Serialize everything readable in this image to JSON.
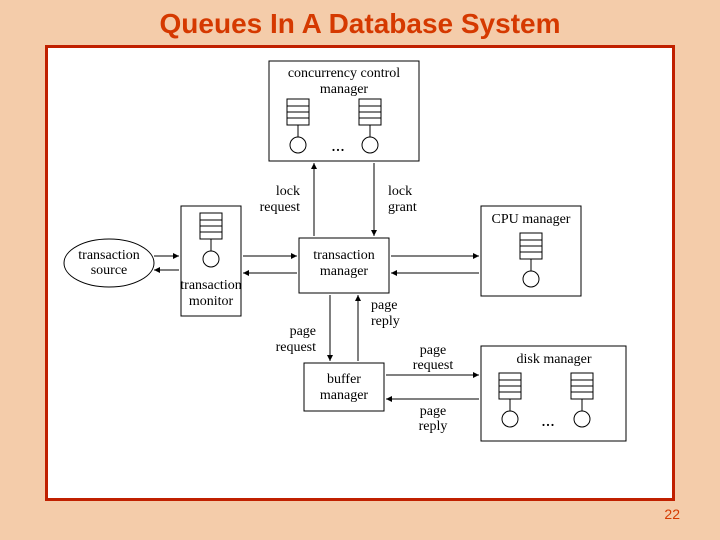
{
  "title": "Queues In A Database System",
  "page_number": "22",
  "boxes": {
    "cc": {
      "label1": "concurrency control",
      "label2": "manager",
      "ellipsis": "..."
    },
    "tm": {
      "label1": "transaction",
      "label2": "manager"
    },
    "mon": {
      "label1": "transaction",
      "label2": "monitor"
    },
    "src": {
      "label1": "transaction",
      "label2": "source"
    },
    "cpu": {
      "label": "CPU manager"
    },
    "buf": {
      "label1": "buffer",
      "label2": "manager"
    },
    "disk": {
      "label": "disk manager",
      "ellipsis": "..."
    }
  },
  "labels": {
    "lock_request": {
      "l1": "lock",
      "l2": "request"
    },
    "lock_grant": {
      "l1": "lock",
      "l2": "grant"
    },
    "page_request_top": {
      "l1": "page",
      "l2": "request"
    },
    "page_reply_top": {
      "l1": "page",
      "l2": "reply"
    },
    "page_request_bot": {
      "l1": "page",
      "l2": "request"
    },
    "page_reply_bot": {
      "l1": "page",
      "l2": "reply"
    }
  }
}
